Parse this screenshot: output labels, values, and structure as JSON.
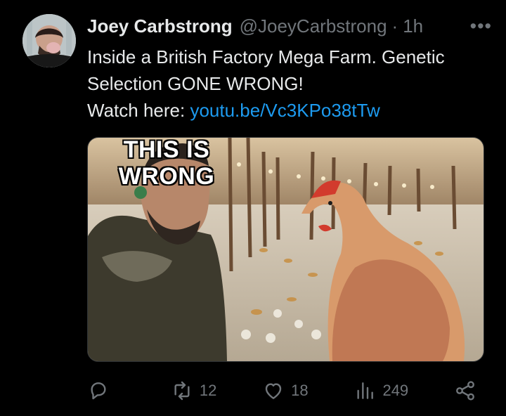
{
  "tweet": {
    "author_name": "Joey Carbstrong",
    "author_handle": "@JoeyCarbstrong",
    "separator": "·",
    "time": "1h",
    "more_label": "•••",
    "text_line1": "Inside a British Factory Mega Farm. Genetic",
    "text_line2": "Selection GONE WRONG!",
    "watch_label": "Watch here:",
    "link_text": "youtu.be/Vc3KPo38tTw"
  },
  "media": {
    "thumbnail_text_line1": "THIS IS",
    "thumbnail_text_line2": "WRONG"
  },
  "actions": {
    "reply": {
      "icon": "reply-icon",
      "count": ""
    },
    "retweet": {
      "icon": "retweet-icon",
      "count": "12"
    },
    "like": {
      "icon": "heart-icon",
      "count": "18"
    },
    "views": {
      "icon": "views-icon",
      "count": "249"
    },
    "share": {
      "icon": "share-icon",
      "count": ""
    }
  },
  "colors": {
    "background": "#000000",
    "text": "#e7e9ea",
    "muted": "#71767b",
    "link": "#1d9bf0"
  }
}
